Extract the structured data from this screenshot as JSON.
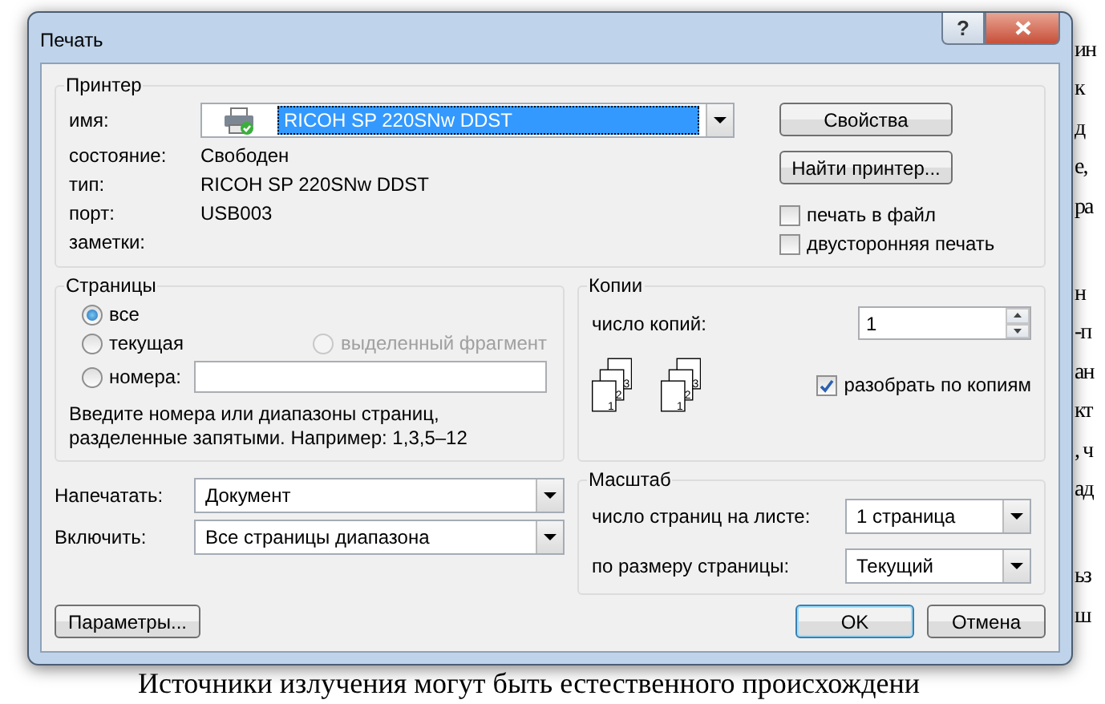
{
  "document": {
    "edge_paragraphs": [
      [
        "ин",
        "к",
        "д",
        "е,",
        "ра"
      ],
      [
        "н",
        "-п",
        "ан",
        "кт",
        ", ч",
        "ад"
      ],
      [
        "ьз",
        "ш"
      ]
    ],
    "bottom_line": "Источники излучения могут быть естественного происхождени"
  },
  "window": {
    "title": "Печать",
    "help": "?"
  },
  "printer": {
    "title": "Принтер",
    "name_label": "имя:",
    "name": "RICOH SP 220SNw DDST",
    "fields": [
      {
        "label": "состояние:",
        "value": "Свободен"
      },
      {
        "label": "тип:",
        "value": "RICOH SP 220SNw DDST"
      },
      {
        "label": "порт:",
        "value": "USB003"
      },
      {
        "label": "заметки:"
      }
    ],
    "buttons": [
      "Свойства",
      "Найти принтер..."
    ],
    "options": [
      {
        "label": "печать в файл",
        "checked": false
      },
      {
        "label": "двусторонняя печать",
        "checked": false
      }
    ]
  },
  "pages": {
    "title": "Страницы",
    "options": [
      {
        "label": "все",
        "selected": true,
        "disabled": false,
        "kind": "plain"
      },
      {
        "label": "текущая",
        "selected": false,
        "disabled": false,
        "kind": "plain"
      },
      {
        "label": "выделенный фрагмент",
        "selected": false,
        "disabled": true,
        "kind": "plain"
      },
      {
        "label": "номера:",
        "selected": false,
        "disabled": false,
        "kind": "range"
      }
    ],
    "hint": "Введите номера или диапазоны страниц, разделенные запятыми. Например: 1,3,5–12"
  },
  "copies": {
    "title": "Копии",
    "count_label": "число копий:",
    "count": "1",
    "stacks": [
      [
        "1",
        "2",
        "3"
      ],
      [
        "1",
        "2",
        "3"
      ]
    ],
    "collate": {
      "label": "разобрать по копиям",
      "checked": true
    }
  },
  "print_what": [
    {
      "label": "Напечатать:",
      "value": "Документ"
    },
    {
      "label": "Включить:",
      "value": "Все страницы диапазона"
    }
  ],
  "scale": {
    "title": "Масштаб",
    "rows": [
      {
        "label": "число страниц на листе:",
        "value": "1 страница"
      },
      {
        "label": "по размеру страницы:",
        "value": "Текущий"
      }
    ]
  },
  "buttons": [
    {
      "label": "Параметры...",
      "default": false
    },
    {
      "label": "OK",
      "default": true
    },
    {
      "label": "Отмена",
      "default": false
    }
  ]
}
